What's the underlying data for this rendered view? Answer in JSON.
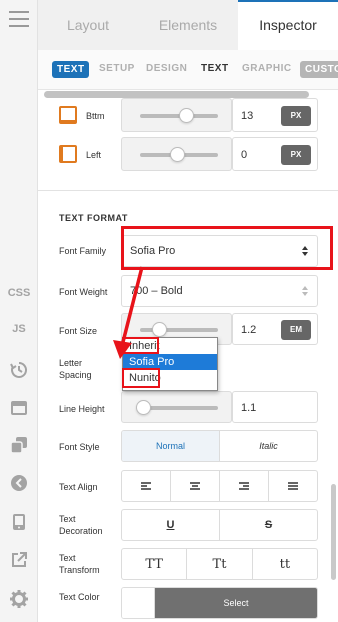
{
  "rail": {
    "css_label": "CSS",
    "js_label": "JS",
    "icons": [
      "menu-icon",
      "history-icon",
      "window-icon",
      "copy-icon",
      "back-icon",
      "device-icon",
      "external-link-icon",
      "gear-icon"
    ]
  },
  "tabs": [
    {
      "label": "Layout",
      "active": false
    },
    {
      "label": "Elements",
      "active": false
    },
    {
      "label": "Inspector",
      "active": true
    }
  ],
  "subtabs": [
    "TEXT",
    "SETUP",
    "DESIGN",
    "TEXT",
    "GRAPHIC",
    "CUSTO"
  ],
  "padding_rows": [
    {
      "label": "Bttm",
      "value": "13",
      "unit": "PX"
    },
    {
      "label": "Left",
      "value": "0",
      "unit": "PX"
    }
  ],
  "text_format": {
    "title": "TEXT FORMAT",
    "font_family": {
      "label": "Font Family",
      "value": "Sofia Pro"
    },
    "font_weight": {
      "label": "Font Weight",
      "value": "700 – Bold"
    },
    "font_size": {
      "label": "Font Size",
      "value": "1.2",
      "unit": "EM"
    },
    "letter_spacing": {
      "label": "Letter Spacing"
    },
    "line_height": {
      "label": "Line Height",
      "value": "1.1"
    },
    "font_style": {
      "label": "Font Style",
      "options": [
        "Normal",
        "Italic"
      ],
      "selected": "Normal"
    },
    "text_align": {
      "label": "Text Align"
    },
    "text_decoration": {
      "label": "Text Decoration",
      "options": [
        "U",
        "S"
      ]
    },
    "text_transform": {
      "label": "Text Transform",
      "options": [
        "TT",
        "Tt",
        "tt"
      ]
    },
    "text_color": {
      "label": "Text Color",
      "button": "Select"
    }
  },
  "dropdown": {
    "options": [
      "Inherit",
      "Sofia Pro",
      "Nunito"
    ],
    "selected": "Sofia Pro"
  },
  "colors": {
    "accent": "#1d72b8",
    "annotation": "#e8131a",
    "dropdown_highlight": "#1e7bd8"
  }
}
